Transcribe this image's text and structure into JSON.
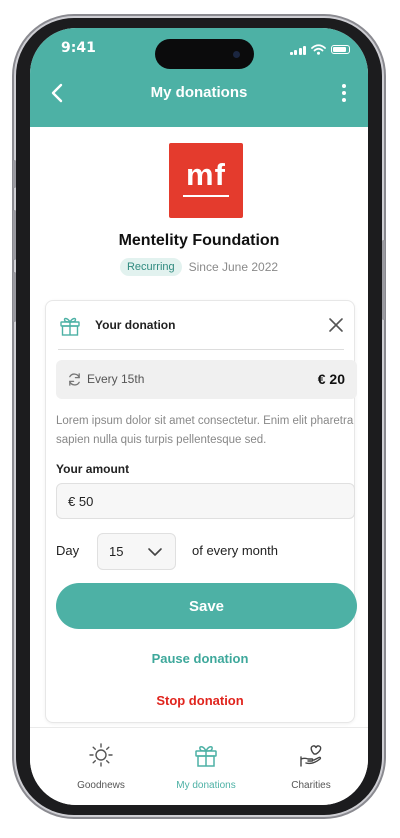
{
  "status_bar": {
    "time": "9:41"
  },
  "header": {
    "title": "My donations"
  },
  "organization": {
    "logo_text": "mf",
    "name": "Mentelity Foundation",
    "status_badge": "Recurring",
    "since": "Since June 2022"
  },
  "donation_card": {
    "title": "Your donation",
    "schedule": {
      "label": "Every 15th",
      "amount": "€ 20"
    },
    "description": "Lorem ipsum dolor sit amet consectetur. Enim elit pharetra sapien nulla quis turpis pellentesque sed.",
    "amount_label": "Your amount",
    "amount_value": "€ 50",
    "day_label": "Day",
    "day_value": "15",
    "day_suffix": "of every month",
    "save_label": "Save",
    "pause_label": "Pause donation",
    "stop_label": "Stop donation"
  },
  "tabs": [
    {
      "label": "Goodnews",
      "icon": "sun-icon",
      "active": false
    },
    {
      "label": "My donations",
      "icon": "gift-icon",
      "active": true
    },
    {
      "label": "Charities",
      "icon": "heart-hand-icon",
      "active": false
    }
  ],
  "colors": {
    "accent": "#4db1a5",
    "logo": "#e43b2d",
    "danger": "#e0241d"
  }
}
